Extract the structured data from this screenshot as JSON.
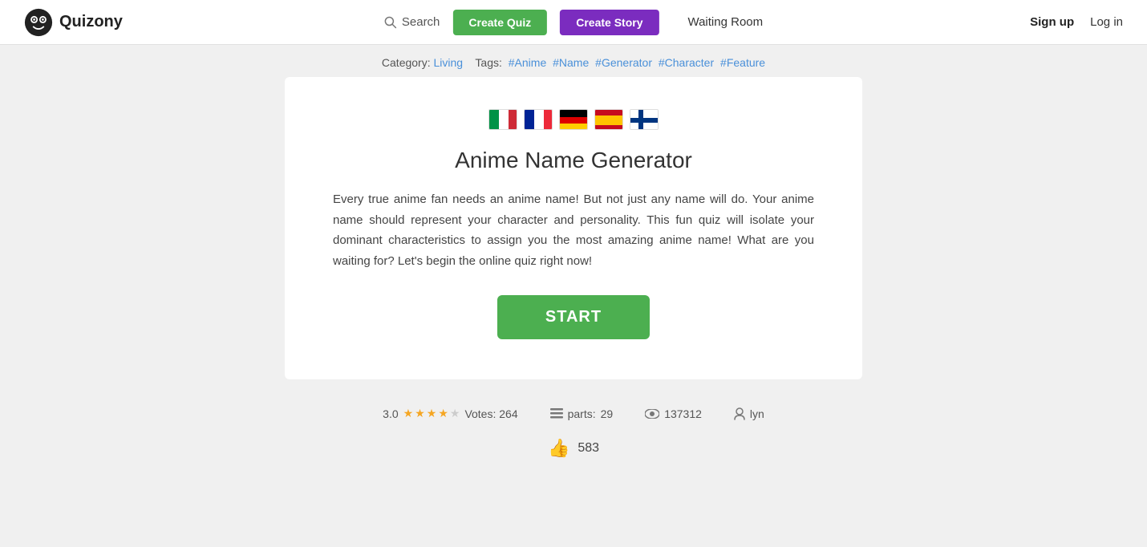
{
  "navbar": {
    "logo_text": "Quizony",
    "search_label": "Search",
    "create_quiz_label": "Create Quiz",
    "create_story_label": "Create Story",
    "waiting_room_label": "Waiting Room",
    "signup_label": "Sign up",
    "login_label": "Log in"
  },
  "category_bar": {
    "category_prefix": "Category:",
    "category_name": "Living",
    "tags_prefix": "Tags:",
    "tags": [
      "#Anime",
      "#Name",
      "#Generator",
      "#Character",
      "#Feature"
    ]
  },
  "quiz": {
    "title": "Anime Name Generator",
    "description": "Every true anime fan needs an anime name! But not just any name will do. Your anime name should represent your character and personality. This fun quiz will isolate your dominant characteristics to assign you the most amazing anime name! What are you waiting for? Let's begin the online quiz right now!",
    "start_label": "START"
  },
  "stats": {
    "rating": "3.0",
    "votes_label": "Votes: 264",
    "parts_label": "parts:",
    "parts_count": "29",
    "views_count": "137312",
    "author": "lyn"
  },
  "likes": {
    "count": "583"
  },
  "flags": [
    {
      "name": "Italy",
      "colors": [
        "#009246",
        "#ffffff",
        "#ce2b37"
      ]
    },
    {
      "name": "France",
      "colors": [
        "#002395",
        "#ffffff",
        "#ed2939"
      ]
    },
    {
      "name": "Germany",
      "colors": [
        "#000000",
        "#dd0000",
        "#ffce00"
      ]
    },
    {
      "name": "Spain",
      "colors": [
        "#c60b1e",
        "#ffc400",
        "#c60b1e"
      ]
    },
    {
      "name": "Finland",
      "bg": "#ffffff",
      "cross": "#003580"
    }
  ]
}
